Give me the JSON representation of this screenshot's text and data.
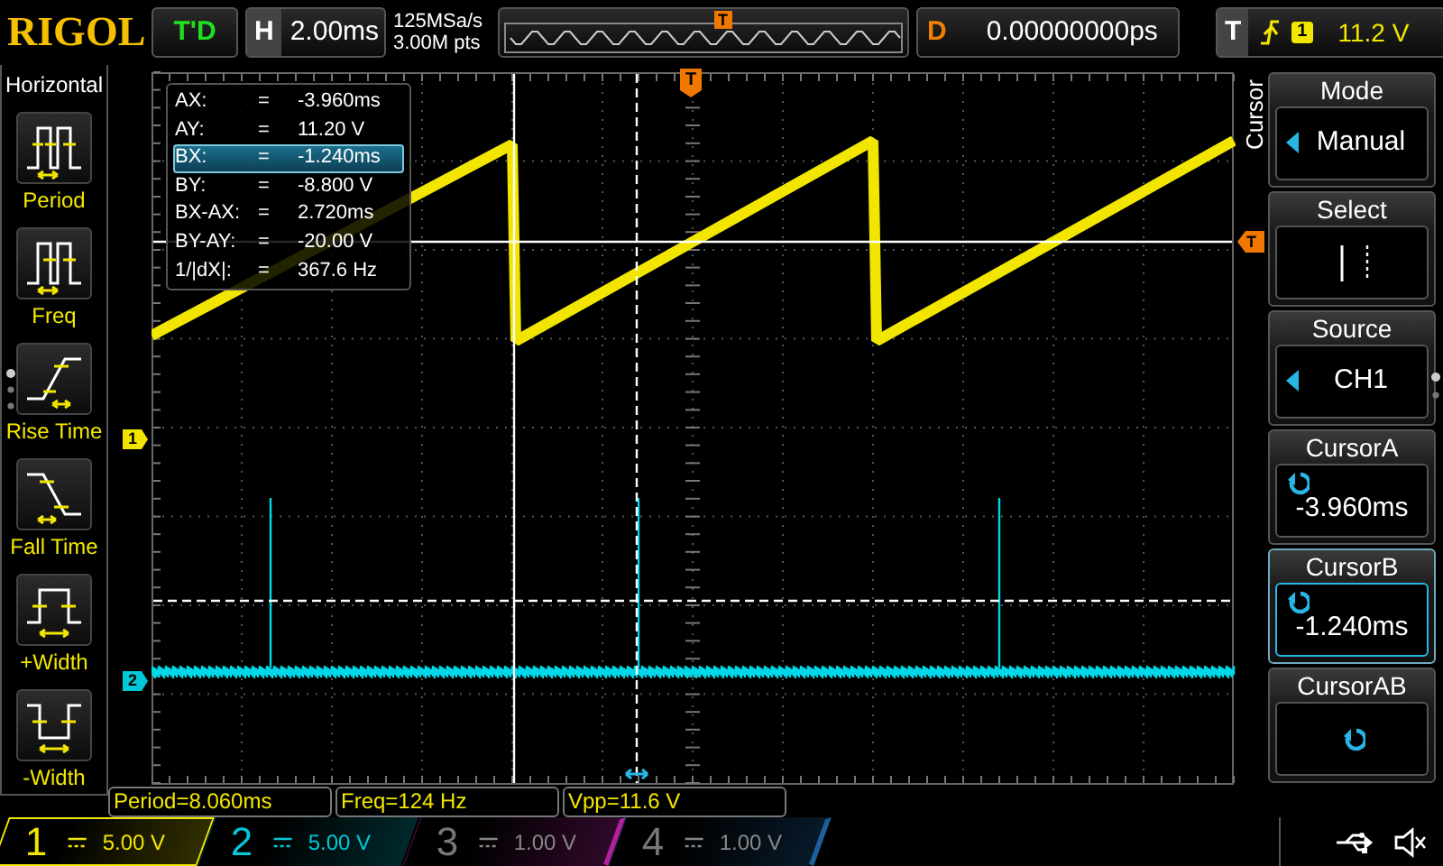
{
  "top_bar": {
    "logo": "RIGOL",
    "run_state": "T'D",
    "timebase_label": "H",
    "timebase": "2.00ms",
    "sample_rate": "125MSa/s",
    "memory_depth": "3.00M pts",
    "overview_marker": "T",
    "delay_label": "D",
    "delay": "0.00000000ps",
    "trigger_label": "T",
    "trigger_source": "1",
    "trigger_level": "11.2 V"
  },
  "left_menu": {
    "title": "Horizontal",
    "items": [
      {
        "label": "Period"
      },
      {
        "label": "Freq"
      },
      {
        "label": "Rise Time"
      },
      {
        "label": "Fall Time"
      },
      {
        "label": "+Width"
      },
      {
        "label": "-Width"
      }
    ]
  },
  "cursor_readout": [
    {
      "name": "AX:",
      "sign": "=",
      "value": "-3.960ms",
      "selected": false
    },
    {
      "name": "AY:",
      "sign": "=",
      "value": "11.20 V",
      "selected": false
    },
    {
      "name": "BX:",
      "sign": "=",
      "value": "-1.240ms",
      "selected": true
    },
    {
      "name": "BY:",
      "sign": "=",
      "value": "-8.800 V",
      "selected": false
    },
    {
      "name": "BX-AX:",
      "sign": "=",
      "value": "2.720ms",
      "selected": false
    },
    {
      "name": "BY-AY:",
      "sign": "=",
      "value": "-20.00 V",
      "selected": false
    },
    {
      "name": "1/|dX|:",
      "sign": "=",
      "value": "367.6 Hz",
      "selected": false
    }
  ],
  "graticule": {
    "trigger_position_marker": "T",
    "trigger_level_marker": "T",
    "channel_markers": [
      {
        "label": "1",
        "color": "#f2e600"
      },
      {
        "label": "2",
        "color": "#00c8d8"
      }
    ]
  },
  "measurements": [
    "Period=8.060ms",
    "Freq=124 Hz",
    "Vpp=11.6 V"
  ],
  "channels": [
    {
      "number": "1",
      "scale": "5.00 V",
      "enabled": true,
      "selected": true,
      "color": "#f2e600"
    },
    {
      "number": "2",
      "scale": "5.00 V",
      "enabled": true,
      "selected": false,
      "color": "#00c8d8"
    },
    {
      "number": "3",
      "scale": "1.00 V",
      "enabled": false,
      "selected": false,
      "color": "#b0209a"
    },
    {
      "number": "4",
      "scale": "1.00 V",
      "enabled": false,
      "selected": false,
      "color": "#1c5f9a"
    }
  ],
  "side_menu": {
    "title": "Cursor",
    "items": [
      {
        "title": "Mode",
        "kind": "option",
        "value": "Manual",
        "selected": false
      },
      {
        "title": "Select",
        "kind": "select",
        "selected": false
      },
      {
        "title": "Source",
        "kind": "option",
        "value": "CH1",
        "selected": false
      },
      {
        "title": "CursorA",
        "kind": "knob",
        "value": "-3.960ms",
        "selected": false
      },
      {
        "title": "CursorB",
        "kind": "knob",
        "value": "-1.240ms",
        "selected": true
      },
      {
        "title": "CursorAB",
        "kind": "knob",
        "selected": false
      }
    ]
  }
}
